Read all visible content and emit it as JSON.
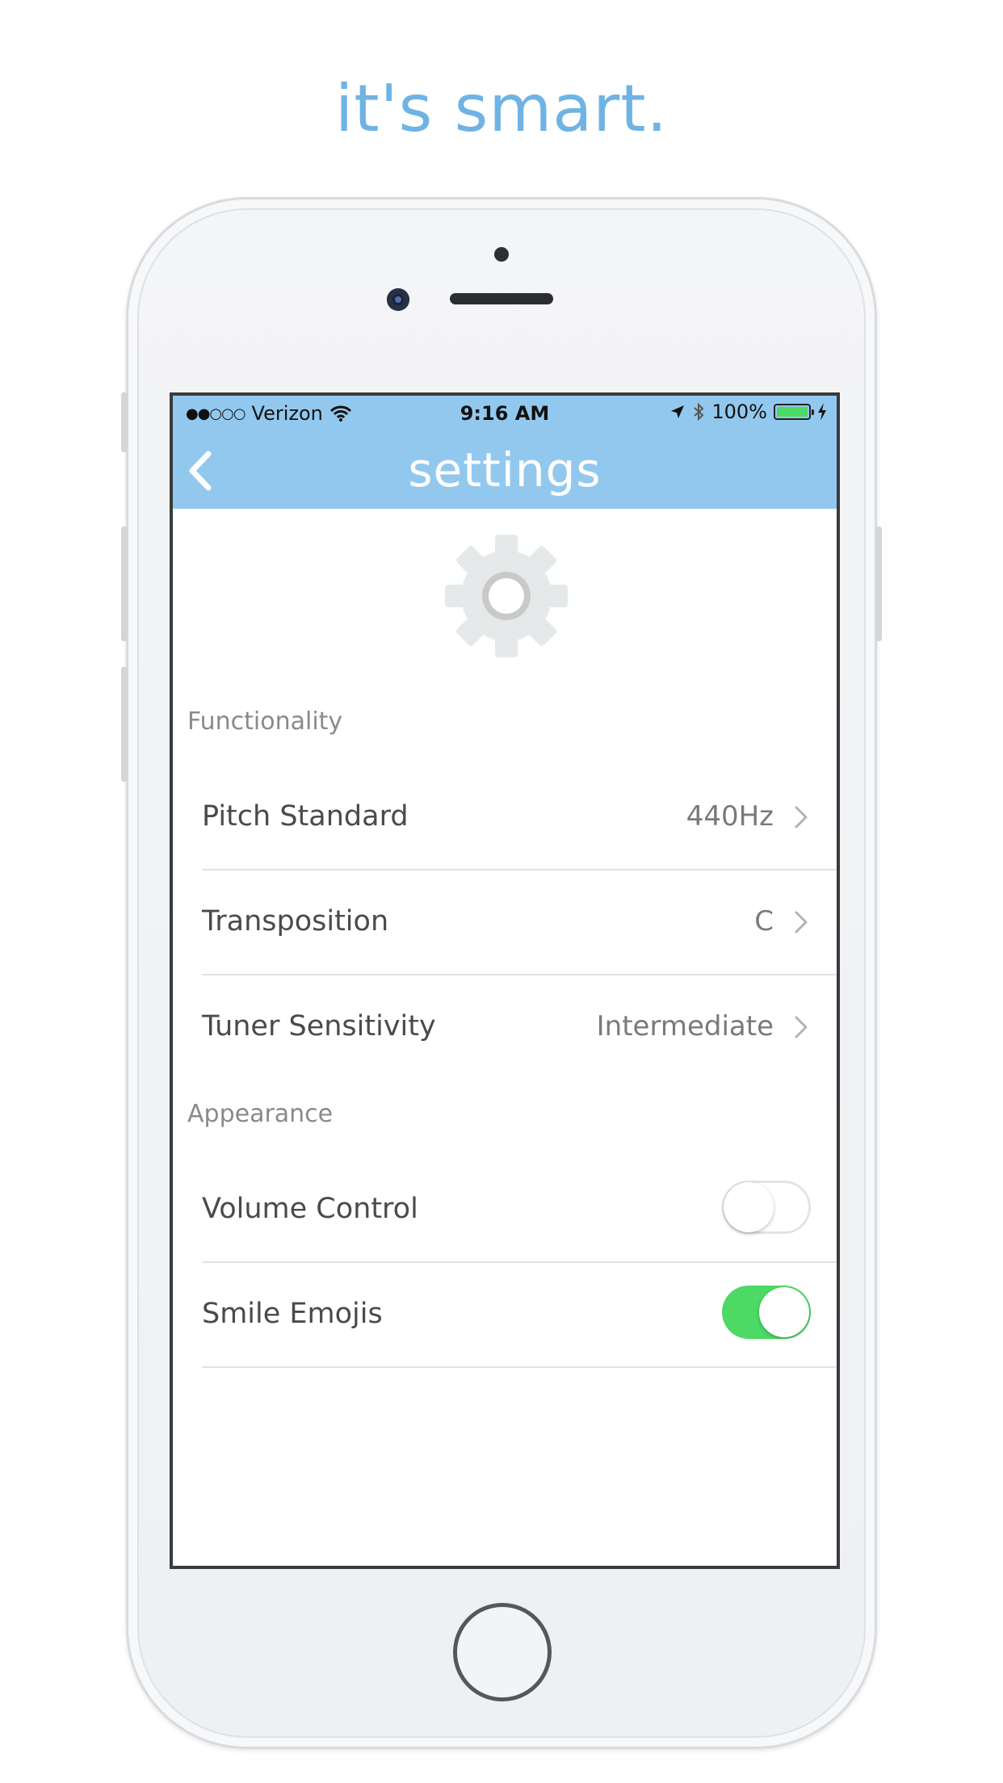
{
  "headline": "it's smart.",
  "status_bar": {
    "signal": "●●○○○",
    "carrier": "Verizon",
    "time": "9:16 AM",
    "battery_percent": "100%"
  },
  "nav": {
    "title": "settings"
  },
  "sections": {
    "functionality": {
      "header": "Functionality",
      "rows": [
        {
          "label": "Pitch Standard",
          "value": "440Hz"
        },
        {
          "label": "Transposition",
          "value": "C"
        },
        {
          "label": "Tuner Sensitivity",
          "value": "Intermediate"
        }
      ]
    },
    "appearance": {
      "header": "Appearance",
      "rows": [
        {
          "label": "Volume Control",
          "enabled": false
        },
        {
          "label": "Smile Emojis",
          "enabled": true
        }
      ]
    }
  },
  "colors": {
    "accent": "#93c8ee",
    "headline": "#6fb3e4",
    "toggle_on": "#4cd964"
  }
}
